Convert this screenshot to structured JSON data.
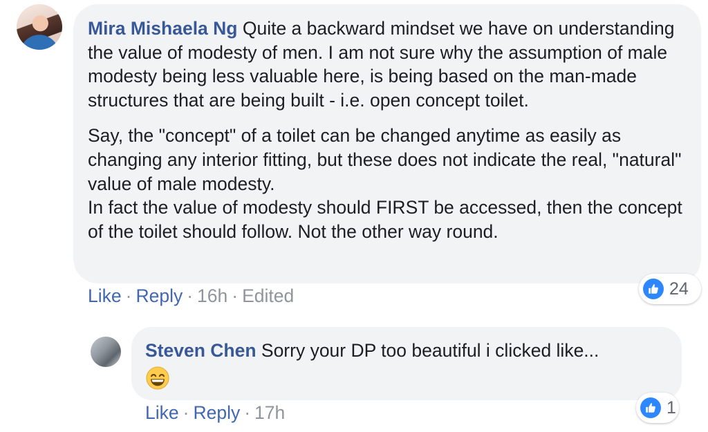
{
  "main_comment": {
    "author": "Mira Mishaela Ng",
    "paragraphs": [
      "Quite a backward mindset we have on understanding the value of modesty of men. I am not sure why the assumption of male modesty being less valuable here, is being based on the man-made structures that are being built - i.e. open concept toilet.",
      "Say, the \"concept\" of a toilet can be changed anytime as easily as changing any interior fitting, but these does not indicate the real, \"natural\" value of male modesty.",
      "In fact the value of modesty should FIRST be accessed, then the concept of the toilet should follow. Not the other way round."
    ],
    "like_label": "Like",
    "reply_label": "Reply",
    "time": "16h",
    "edited": "Edited",
    "separator": "·",
    "reaction_icon": "thumbs-up-icon",
    "reaction_count": "24"
  },
  "reply_comment": {
    "author": "Steven Chen",
    "text": "Sorry your DP too beautiful i clicked like...",
    "emoji": "grinning-smiling-eyes-emoji",
    "like_label": "Like",
    "reply_label": "Reply",
    "time": "17h",
    "separator": "·",
    "reaction_icon": "thumbs-up-icon",
    "reaction_count": "1"
  },
  "colors": {
    "author": "#385898",
    "link": "#4267b2",
    "meta": "#90949c",
    "bubble": "#f2f3f5",
    "like_blue": "#2d88ff"
  }
}
